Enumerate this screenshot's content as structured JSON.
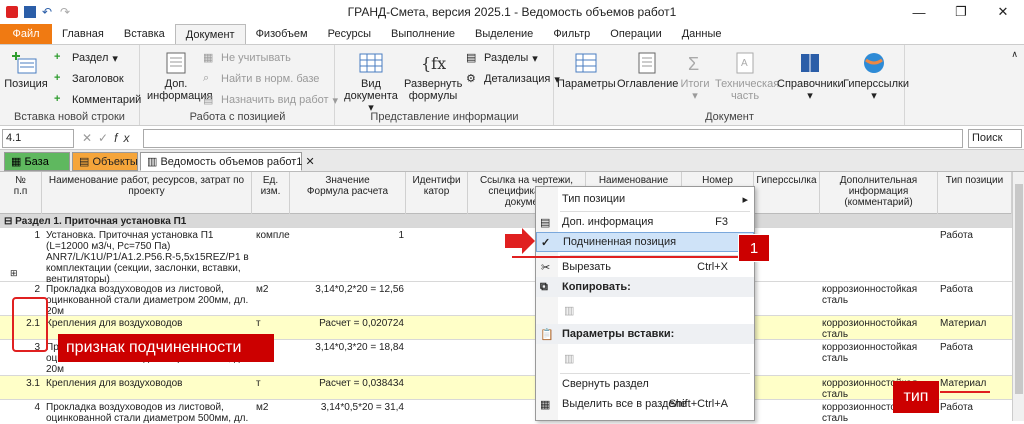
{
  "window": {
    "title": "ГРАНД-Смета, версия 2025.1 - Ведомость объемов работ1"
  },
  "menu": [
    "Файл",
    "Главная",
    "Вставка",
    "Документ",
    "Физобъем",
    "Ресурсы",
    "Выполнение",
    "Выделение",
    "Фильтр",
    "Операции",
    "Данные"
  ],
  "ribbon": {
    "insert_row": {
      "position": "Позиция",
      "section": "Раздел",
      "heading": "Заголовок",
      "comment": "Комментарий",
      "group": "Вставка новой строки"
    },
    "work": {
      "add_info": "Доп.",
      "add_info2": "информация",
      "ignore": "Не учитывать",
      "find": "Найти в норм. базе",
      "assign": "Назначить вид работ",
      "group": "Работа с позицией"
    },
    "view": {
      "doc_view": "Вид",
      "doc_view2": "документа",
      "expand": "Развернуть",
      "expand2": "формулы",
      "sections": "Разделы",
      "detail": "Детализация",
      "group": "Представление информации"
    },
    "doc": {
      "params": "Параметры",
      "toc": "Оглавление",
      "totals": "Итоги",
      "tech": "Техническая",
      "tech2": "часть",
      "refs": "Справочники",
      "hyper": "Гиперссылки",
      "group": "Документ"
    }
  },
  "formula_bar": {
    "cell": "4.1",
    "search": "Поиск"
  },
  "tabs": {
    "base": "База",
    "objects": "Объекты",
    "doc": "Ведомость объемов работ1"
  },
  "headers": [
    "№\nп.п",
    "Наименование работ, ресурсов, затрат по\nпроекту",
    "Ед. изм.",
    "Значение\nФормула расчета",
    "Идентифи\nкатор",
    "Ссылка на чертежи,\nспецификации в\nдокумент",
    "Наименование файла",
    "Номер страниц",
    "Гиперссылка",
    "Дополнительная\nинформация (комментарий)",
    "Тип позиции"
  ],
  "section_title": "Раздел 1. Приточная установка П1",
  "rows": [
    {
      "n": "1",
      "name": "Установка. Приточная установка  П1 (L=12000 м3/ч, Pc=750 Па) ANR7/L/K1U/P1/A1.2.P56.R-5,5x15REZ/P1 в комплектации (секции, заслонки, вставки, вентиляторы)",
      "unit": "комплект",
      "val": "1",
      "info": "",
      "type": "Работа"
    },
    {
      "n": "2",
      "name": "Прокладка воздуховодов из листовой, оцинкованной стали диаметром 200мм, дл. 20м",
      "unit": "м2",
      "val": "3,14*0,2*20 = 12,56",
      "info": "коррозионностойкая сталь",
      "type": "Работа"
    },
    {
      "n": "2.1",
      "name": "Крепления для воздуховодов",
      "unit": "т",
      "val": "Расчет = 0,020724",
      "info": "коррозионностойкая сталь",
      "type": "Материал"
    },
    {
      "n": "3",
      "name": "Прокладка воздуховодов из листовой, оцинкованной стали диаметром 300мм, дл. 20м",
      "unit": "м2",
      "val": "3,14*0,3*20 = 18,84",
      "info": "коррозионностойкая сталь",
      "type": "Работа"
    },
    {
      "n": "3.1",
      "name": "Крепления для воздуховодов",
      "unit": "т",
      "val": "Расчет = 0,038434",
      "info": "коррозионностойкая сталь",
      "type": "Материал"
    },
    {
      "n": "4",
      "name": "Прокладка воздуховодов из листовой, оцинкованной стали диаметром 500мм, дл.",
      "unit": "м2",
      "val": "3,14*0,5*20 = 31,4",
      "info": "коррозионностойкая сталь",
      "type": "Работа"
    }
  ],
  "context_menu": {
    "type_pos": "Тип позиции",
    "add_info": "Доп. информация",
    "add_info_sc": "F3",
    "subordinate": "Подчиненная позиция",
    "cut": "Вырезать",
    "cut_sc": "Ctrl+X",
    "copy": "Копировать:",
    "paste": "Параметры вставки:",
    "collapse": "Свернуть раздел",
    "select_all": "Выделить все в разделе",
    "select_all_sc": "Shift+Ctrl+A"
  },
  "annotations": {
    "sub_label": "признак подчиненности",
    "type_label": "тип",
    "step": "1"
  },
  "colors": {
    "accent": "#f07a12",
    "highlight": "#ffffc8",
    "annotation": "#e02020"
  }
}
